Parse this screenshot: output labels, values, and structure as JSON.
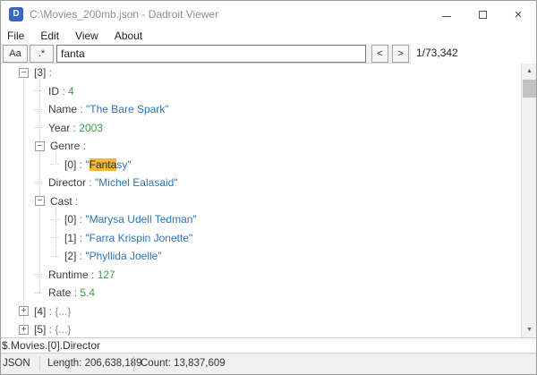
{
  "window": {
    "title": "C:\\Movies_200mb.json - Dadroit Viewer",
    "minimize_glyph": "–",
    "close_glyph": "×"
  },
  "menu": {
    "items": [
      {
        "label": "File"
      },
      {
        "label": "Edit"
      },
      {
        "label": "View"
      },
      {
        "label": "About"
      }
    ]
  },
  "toolbar": {
    "match_case_label": "Aa",
    "regex_label": ".*",
    "search_value": "fanta",
    "prev_label": "<",
    "next_label": ">",
    "match_counter": "1/73,342"
  },
  "tree": {
    "expander_glyphs": {
      "minus": "−",
      "plus": "+"
    },
    "rows": [
      {
        "level": 1,
        "expander": "minus",
        "key": "[3]"
      },
      {
        "level": 2,
        "key": "ID",
        "value": "4",
        "vtype": "number"
      },
      {
        "level": 2,
        "key": "Name",
        "value": "\"The Bare Spark\"",
        "vtype": "string"
      },
      {
        "level": 2,
        "key": "Year",
        "value": "2003",
        "vtype": "number"
      },
      {
        "level": 2,
        "expander": "minus",
        "key": "Genre"
      },
      {
        "level": 3,
        "key": "[0]",
        "vtype": "string_highlight",
        "value_pre": "\"",
        "value_hl": "Fanta",
        "value_post": "sy\""
      },
      {
        "level": 2,
        "key": "Director",
        "value": "\"Michel Ealasaid\"",
        "vtype": "string"
      },
      {
        "level": 2,
        "expander": "minus",
        "key": "Cast"
      },
      {
        "level": 3,
        "key": "[0]",
        "value": "\"Marysa Udell Tedman\"",
        "vtype": "string"
      },
      {
        "level": 3,
        "key": "[1]",
        "value": "\"Farra Krispin Jonette\"",
        "vtype": "string"
      },
      {
        "level": 3,
        "key": "[2]",
        "value": "\"Phyllida Joelle\"",
        "vtype": "string"
      },
      {
        "level": 2,
        "key": "Runtime",
        "value": "127",
        "vtype": "number"
      },
      {
        "level": 2,
        "key": "Rate",
        "value": "5.4",
        "vtype": "number"
      },
      {
        "level": 1,
        "expander": "plus",
        "key": "[4]",
        "value": "{...}",
        "vtype": "object"
      },
      {
        "level": 1,
        "expander": "plus",
        "key": "[5]",
        "value": "{...}",
        "vtype": "object"
      }
    ]
  },
  "path_bar": {
    "path": "$.Movies.[0].Director"
  },
  "status_bar": {
    "format": "JSON",
    "length": "Length: 206,638,189",
    "count": "Count: 13,837,609"
  },
  "colors": {
    "string_value": "#2e74b5",
    "number_value": "#3e9e54",
    "object_value": "#7191bb",
    "highlight_bg": "#f3b73e",
    "window_icon_bg": "#3a66c1"
  }
}
